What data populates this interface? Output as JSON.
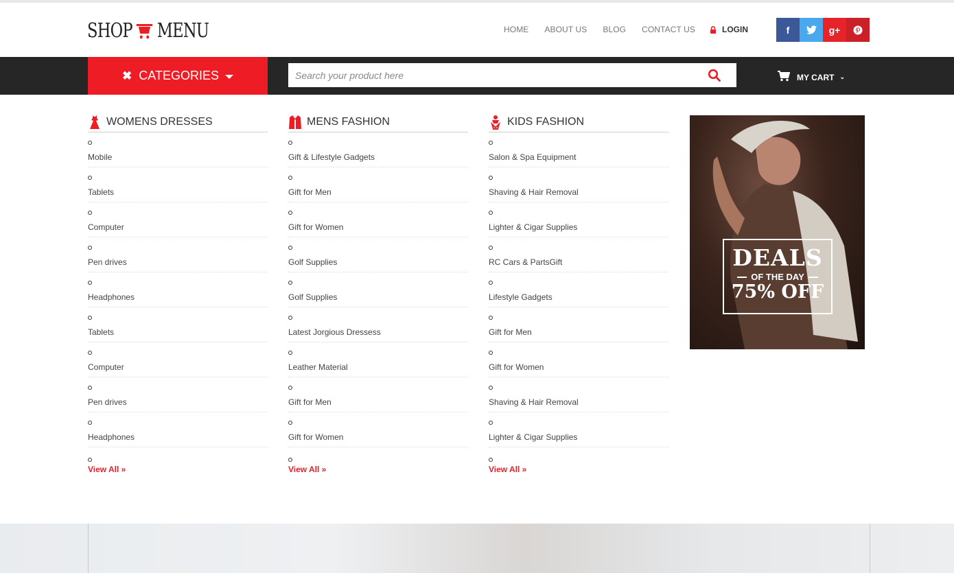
{
  "logo": {
    "left": "SHOP",
    "right": "MENU"
  },
  "nav": [
    {
      "label": "HOME"
    },
    {
      "label": "ABOUT US"
    },
    {
      "label": "BLOG"
    },
    {
      "label": "CONTACT US"
    }
  ],
  "login": {
    "label": "LOGIN"
  },
  "social": [
    {
      "name": "facebook",
      "glyph": "f",
      "color": "#3b5998"
    },
    {
      "name": "twitter",
      "glyph": "t",
      "color": "#4aa9ec"
    },
    {
      "name": "google-plus",
      "glyph": "g+",
      "color": "#e6222b"
    },
    {
      "name": "pinterest",
      "glyph": "p",
      "color": "#cb2027"
    }
  ],
  "categories": {
    "label": "CATEGORIES",
    "color": "#ee1c25"
  },
  "search": {
    "placeholder": "Search your product here"
  },
  "cart": {
    "label": "MY CART"
  },
  "columns": [
    {
      "title": "WOMENS DRESSES",
      "icon": "dress-icon",
      "items": [
        "Mobile",
        "Tablets",
        "Computer",
        "Pen drives",
        "Headphones",
        "Tablets",
        "Computer",
        "Pen drives",
        "Headphones"
      ],
      "view_all": "View All »"
    },
    {
      "title": "MENS FASHION",
      "icon": "jacket-icon",
      "items": [
        "Gift & Lifestyle Gadgets",
        "Gift for Men",
        "Gift for Women",
        "Golf Supplies",
        "Golf Supplies",
        "Latest Jorgious Dressess",
        "Leather Material",
        "Gift for Men",
        "Gift for Women"
      ],
      "view_all": "View All »"
    },
    {
      "title": "KIDS FASHION",
      "icon": "kid-icon",
      "items": [
        "Salon & Spa Equipment",
        "Shaving & Hair Removal",
        "Lighter & Cigar Supplies",
        "RC Cars & PartsGift",
        "Lifestyle Gadgets",
        "Gift for Men",
        "Gift for Women",
        "Shaving & Hair Removal",
        "Lighter & Cigar Supplies"
      ],
      "view_all": "View All »"
    }
  ],
  "banner": {
    "line1": "DEALS",
    "line2": "OF THE DAY",
    "line3": "75% OFF"
  }
}
